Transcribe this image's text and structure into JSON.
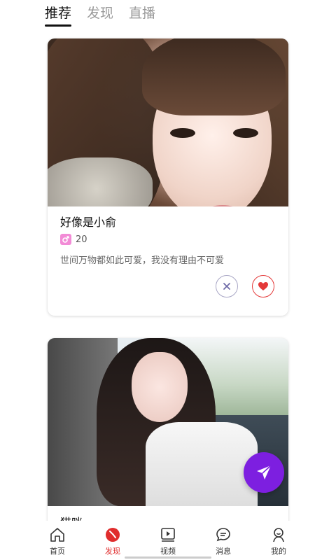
{
  "top_tabs": [
    {
      "label": "推荐"
    },
    {
      "label": "发现"
    },
    {
      "label": "直播"
    }
  ],
  "cards": [
    {
      "name": "好像是小俞",
      "age": "20",
      "bio": "世间万物都如此可爱，我没有理由不可爱",
      "actions": {
        "dislike_icon": "x-icon",
        "like_icon": "heart-icon"
      }
    },
    {
      "name": "猫咪"
    }
  ],
  "fab": {
    "icon": "send-icon",
    "color": "#7d1fe0"
  },
  "bottom_nav": [
    {
      "label": "首页",
      "icon": "home-icon"
    },
    {
      "label": "发现",
      "icon": "discover-icon"
    },
    {
      "label": "视频",
      "icon": "video-icon"
    },
    {
      "label": "消息",
      "icon": "message-icon"
    },
    {
      "label": "我的",
      "icon": "profile-icon"
    }
  ],
  "colors": {
    "accent": "#e02d2d",
    "like": "#e43a3a",
    "fab": "#7d1fe0"
  }
}
